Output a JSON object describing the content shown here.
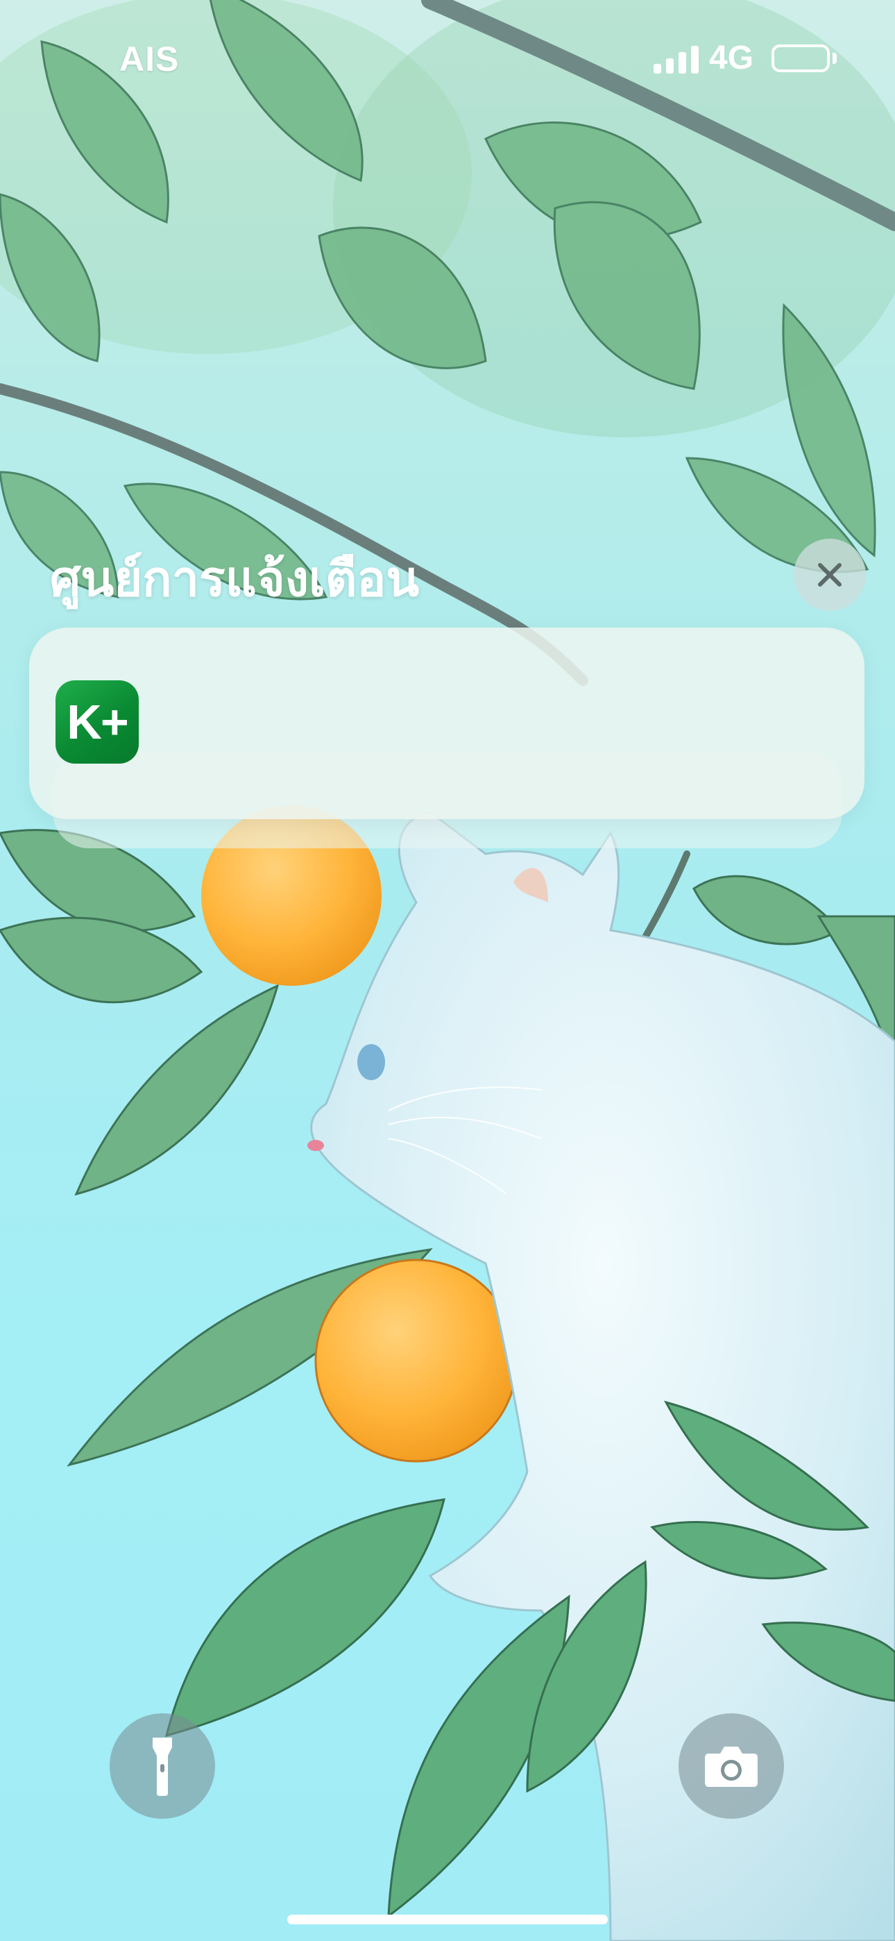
{
  "status_bar": {
    "carrier": "AIS",
    "network": "4G",
    "signal_bars": 4,
    "battery_level": 0
  },
  "notification_center": {
    "title": "ศูนย์การแจ้งเตือน",
    "clear_icon": "close-icon"
  },
  "notifications": [
    {
      "app_icon_text": "K+",
      "app_icon_color": "#0a8a33"
    }
  ],
  "controls": {
    "flashlight_icon": "flashlight-icon",
    "camera_icon": "camera-icon"
  }
}
